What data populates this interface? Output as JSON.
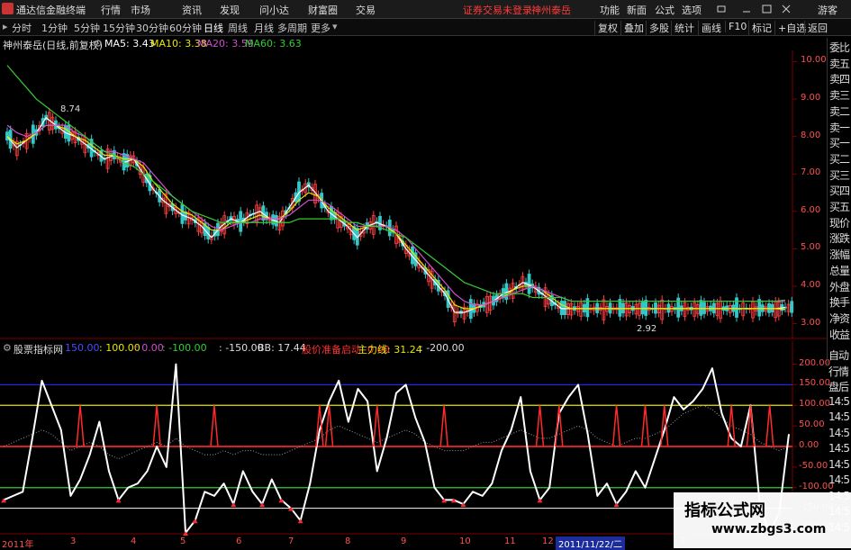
{
  "app": {
    "title": "通达信金融终端"
  },
  "menu": {
    "items": [
      "行情",
      "市场",
      "资讯",
      "发现",
      "问小达",
      "财富圈",
      "交易"
    ],
    "alert": "证券交易未登录",
    "stock": "神州泰岳",
    "right": [
      "功能",
      "新面",
      "公式",
      "选项",
      "游客"
    ]
  },
  "toolbar": {
    "periods": [
      "分时",
      "1分钟",
      "5分钟",
      "15分钟",
      "30分钟",
      "60分钟",
      "日线",
      "周线",
      "月线",
      "多周期",
      "更多"
    ],
    "active": "日线",
    "right": [
      "复权",
      "叠加",
      "多股",
      "统计",
      "画线",
      "F10",
      "标记",
      "+自选",
      "返回"
    ]
  },
  "main_legend": {
    "name": "神州泰岳(日线,前复权)",
    "ma5": "MA5: 3.43",
    "ma10": "MA10: 3.38",
    "ma20": "MA20: 3.59",
    "ma60": "MA60: 3.63"
  },
  "sub_legend": {
    "name": "股票指标网",
    "l150": "150.00",
    "l100": ": 100.00",
    "l0": ": 0.00",
    "lm100": ": -100.00",
    "lm150": ": -150.00",
    "bb": "BB: 17.44",
    "bottom": "股价准备启动: 0.00",
    "main": "主力线: 31.24",
    "lm200": ": -200.00"
  },
  "annotations": {
    "high": "8.74",
    "low": "2.92",
    "cursor": "2011/11/22/二"
  },
  "right_panel": {
    "items": [
      "委比",
      "卖五",
      "卖四",
      "卖三",
      "卖二",
      "卖一",
      "买一",
      "买二",
      "买三",
      "买四",
      "买五",
      "现价",
      "涨跌",
      "涨幅",
      "总量",
      "外盘",
      "换手",
      "净资",
      "收益"
    ],
    "items2": [
      "自动",
      "行情",
      "盘后",
      "14:5",
      "14:5",
      "14:5",
      "14:5",
      "14:5",
      "14:5",
      "14:5",
      "14:5",
      "14:5"
    ]
  },
  "colors": {
    "ma5": "#ffffff",
    "ma10": "#e6e600",
    "ma20": "#d04fd0",
    "ma60": "#33cc33",
    "up": "#ff4040",
    "down": "#33c8c8",
    "grid": "#7a0000",
    "blue": "#2424ff",
    "main_line": "#ffffff",
    "signal": "#ff2a2a"
  },
  "chart_data": [
    {
      "type": "line",
      "title": "神州泰岳(日线,前复权)",
      "y_ticks": [
        "10.00",
        "9.00",
        "8.00",
        "7.00",
        "6.00",
        "5.00",
        "4.00",
        "3.00"
      ],
      "ylim": [
        2.7,
        10.3
      ],
      "x_ticks": [
        "2011年",
        "3",
        "4",
        "5",
        "6",
        "7",
        "8",
        "9",
        "10",
        "11",
        "12",
        "2"
      ],
      "x": [
        0,
        1,
        2,
        3,
        4,
        5,
        6,
        7,
        8,
        9,
        10,
        11,
        12,
        13,
        14,
        15,
        16,
        17,
        18,
        19,
        20,
        21,
        22,
        23,
        24,
        25,
        26,
        27,
        28,
        29,
        30,
        31,
        32,
        33,
        34,
        35,
        36,
        37,
        38,
        39,
        40,
        41,
        42,
        43,
        44,
        45,
        46,
        47,
        48,
        49,
        50,
        51,
        52,
        53,
        54,
        55,
        56,
        57,
        58,
        59,
        60,
        61,
        62,
        63,
        64,
        65,
        66,
        67,
        68,
        69,
        70,
        71,
        72,
        73,
        74,
        75,
        76,
        77,
        78,
        79,
        80
      ],
      "series": [
        {
          "name": "MA5",
          "values": [
            8.0,
            7.7,
            7.9,
            8.1,
            8.5,
            8.3,
            8.1,
            8.0,
            7.8,
            7.6,
            7.4,
            7.5,
            7.3,
            7.4,
            7.0,
            6.6,
            6.3,
            6.1,
            5.9,
            5.8,
            5.6,
            5.3,
            5.6,
            5.8,
            5.7,
            5.9,
            6.0,
            5.8,
            5.7,
            6.1,
            6.5,
            6.7,
            6.4,
            6.0,
            5.8,
            5.6,
            5.3,
            5.6,
            5.7,
            5.6,
            5.4,
            5.0,
            4.7,
            4.4,
            4.1,
            3.8,
            3.3,
            3.3,
            3.4,
            3.5,
            3.6,
            3.8,
            3.9,
            4.1,
            4.0,
            3.8,
            3.6,
            3.4,
            3.4,
            3.4,
            3.4,
            3.4,
            3.4,
            3.4,
            3.4,
            3.4,
            3.4,
            3.4,
            3.4,
            3.4,
            3.4,
            3.4,
            3.4,
            3.4,
            3.4,
            3.4,
            3.4,
            3.4,
            3.4,
            3.4,
            3.43
          ]
        },
        {
          "name": "MA10",
          "values": [
            8.0,
            7.8,
            7.9,
            8.1,
            8.3,
            8.3,
            8.2,
            8.0,
            7.9,
            7.7,
            7.5,
            7.5,
            7.4,
            7.4,
            7.2,
            6.8,
            6.5,
            6.2,
            6.0,
            5.9,
            5.7,
            5.5,
            5.5,
            5.7,
            5.7,
            5.8,
            5.9,
            5.8,
            5.8,
            6.0,
            6.3,
            6.5,
            6.4,
            6.1,
            5.9,
            5.7,
            5.5,
            5.6,
            5.6,
            5.6,
            5.4,
            5.1,
            4.8,
            4.5,
            4.2,
            3.9,
            3.5,
            3.4,
            3.4,
            3.5,
            3.6,
            3.7,
            3.9,
            4.0,
            4.0,
            3.9,
            3.7,
            3.5,
            3.4,
            3.4,
            3.4,
            3.4,
            3.4,
            3.4,
            3.4,
            3.4,
            3.4,
            3.4,
            3.4,
            3.4,
            3.4,
            3.4,
            3.4,
            3.4,
            3.4,
            3.4,
            3.4,
            3.4,
            3.4,
            3.4,
            3.38
          ]
        },
        {
          "name": "MA20",
          "values": [
            8.3,
            8.1,
            8.0,
            8.1,
            8.3,
            8.3,
            8.3,
            8.1,
            8.0,
            7.8,
            7.6,
            7.6,
            7.5,
            7.4,
            7.3,
            7.0,
            6.7,
            6.4,
            6.2,
            6.0,
            5.8,
            5.6,
            5.5,
            5.6,
            5.7,
            5.7,
            5.8,
            5.8,
            5.8,
            5.9,
            6.1,
            6.3,
            6.3,
            6.2,
            6.0,
            5.8,
            5.6,
            5.6,
            5.6,
            5.6,
            5.5,
            5.3,
            5.0,
            4.7,
            4.4,
            4.1,
            3.8,
            3.6,
            3.5,
            3.5,
            3.6,
            3.7,
            3.8,
            3.9,
            4.0,
            3.9,
            3.8,
            3.7,
            3.6,
            3.6,
            3.6,
            3.6,
            3.6,
            3.6,
            3.6,
            3.6,
            3.6,
            3.6,
            3.6,
            3.6,
            3.6,
            3.6,
            3.6,
            3.6,
            3.6,
            3.6,
            3.6,
            3.6,
            3.6,
            3.6,
            3.59
          ]
        },
        {
          "name": "MA60",
          "values": [
            9.9,
            9.6,
            9.3,
            9.0,
            8.8,
            8.6,
            8.4,
            8.2,
            8.0,
            7.8,
            7.6,
            7.5,
            7.3,
            7.2,
            7.0,
            6.8,
            6.6,
            6.4,
            6.2,
            6.0,
            5.9,
            5.8,
            5.7,
            5.7,
            5.7,
            5.7,
            5.7,
            5.7,
            5.7,
            5.7,
            5.8,
            5.8,
            5.8,
            5.8,
            5.8,
            5.7,
            5.7,
            5.6,
            5.6,
            5.5,
            5.4,
            5.3,
            5.1,
            4.9,
            4.7,
            4.5,
            4.3,
            4.1,
            4.0,
            3.9,
            3.8,
            3.8,
            3.8,
            3.8,
            3.7,
            3.7,
            3.7,
            3.7,
            3.6,
            3.6,
            3.6,
            3.6,
            3.6,
            3.6,
            3.6,
            3.6,
            3.6,
            3.6,
            3.6,
            3.6,
            3.6,
            3.6,
            3.6,
            3.6,
            3.6,
            3.6,
            3.6,
            3.6,
            3.6,
            3.6,
            3.63
          ]
        }
      ]
    },
    {
      "type": "line",
      "title": "股票指标网",
      "y_ticks": [
        "200.00",
        "150.00",
        "100.00",
        "50.00",
        "0.00",
        "-50.00",
        "-100.00",
        "-150.00",
        "-200.00"
      ],
      "ylim": [
        -210,
        210
      ],
      "reference_lines": [
        150,
        100,
        0,
        -100,
        -150
      ],
      "series": [
        {
          "name": "主力线",
          "values": [
            -130,
            -120,
            -110,
            20,
            160,
            100,
            40,
            -120,
            -80,
            -20,
            60,
            -60,
            -130,
            -100,
            -90,
            -60,
            0,
            -50,
            200,
            -210,
            -180,
            -110,
            -120,
            -90,
            -140,
            -60,
            -110,
            -140,
            -80,
            -130,
            -150,
            -180,
            -90,
            40,
            110,
            160,
            60,
            140,
            110,
            -60,
            20,
            130,
            150,
            70,
            10,
            -100,
            -130,
            -130,
            -140,
            -110,
            -120,
            -90,
            -10,
            40,
            120,
            -60,
            -130,
            -100,
            80,
            120,
            150,
            30,
            -120,
            -90,
            -140,
            -110,
            -60,
            -100,
            -30,
            40,
            120,
            90,
            110,
            140,
            190,
            80,
            20,
            0,
            100,
            -150,
            -210,
            -160,
            30
          ]
        },
        {
          "name": "BB",
          "values": [
            0,
            10,
            20,
            30,
            40,
            30,
            10,
            -10,
            0,
            10,
            0,
            -20,
            -30,
            -20,
            -10,
            0,
            10,
            0,
            20,
            0,
            -10,
            -20,
            -20,
            -10,
            -20,
            -10,
            -10,
            -20,
            -20,
            -20,
            -10,
            0,
            10,
            20,
            40,
            50,
            40,
            30,
            20,
            10,
            20,
            30,
            40,
            30,
            10,
            0,
            -10,
            -10,
            -10,
            0,
            10,
            10,
            20,
            30,
            40,
            30,
            20,
            20,
            30,
            40,
            50,
            40,
            20,
            10,
            0,
            10,
            20,
            20,
            30,
            40,
            60,
            80,
            90,
            100,
            90,
            70,
            50,
            40,
            30,
            10,
            0,
            -10,
            0
          ]
        }
      ],
      "signals_x": [
        8,
        16,
        22,
        33,
        34,
        39,
        46,
        56,
        58,
        64,
        67,
        69,
        76,
        78,
        80
      ]
    }
  ]
}
